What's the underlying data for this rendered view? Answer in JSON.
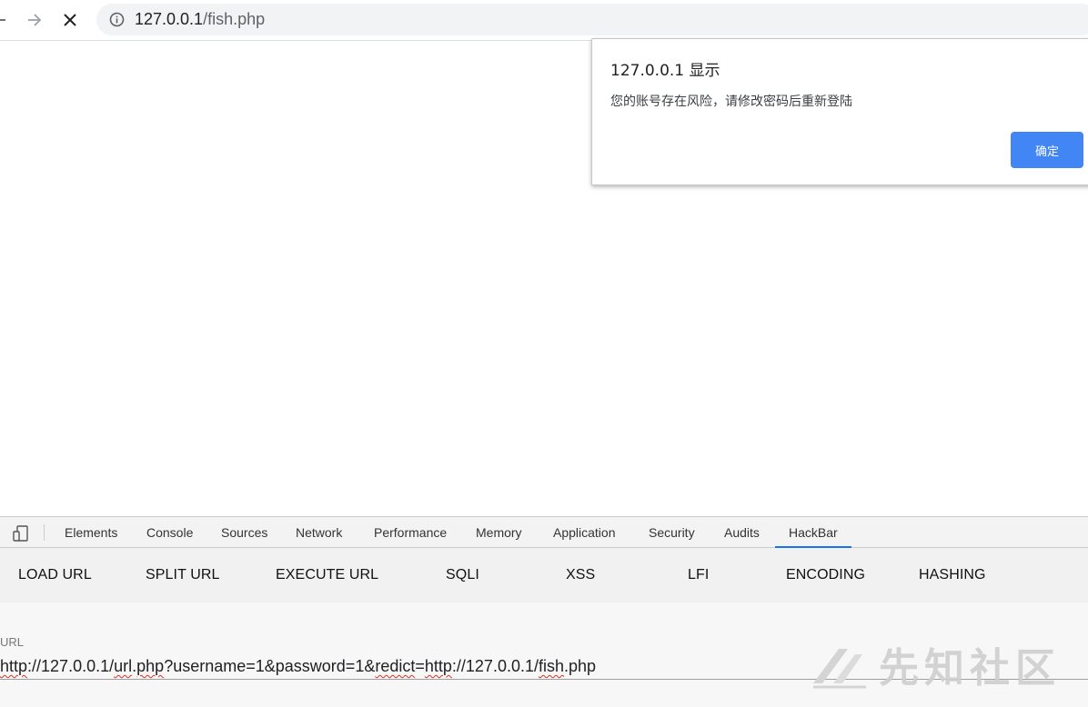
{
  "browser": {
    "address_host": "127.0.0.1",
    "address_path": "/fish.php"
  },
  "alert": {
    "title": "127.0.0.1 显示",
    "message": "您的账号存在风险，请修改密码后重新登陆",
    "ok_label": "确定"
  },
  "devtools": {
    "tabs": [
      {
        "label": "Elements"
      },
      {
        "label": "Console"
      },
      {
        "label": "Sources"
      },
      {
        "label": "Network"
      },
      {
        "label": "Performance"
      },
      {
        "label": "Memory"
      },
      {
        "label": "Application"
      },
      {
        "label": "Security"
      },
      {
        "label": "Audits"
      },
      {
        "label": "HackBar"
      }
    ],
    "active_tab": "HackBar"
  },
  "hackbar": {
    "menu": [
      {
        "label": "LOAD URL"
      },
      {
        "label": "SPLIT URL"
      },
      {
        "label": "EXECUTE URL"
      },
      {
        "label": "SQLI"
      },
      {
        "label": "XSS"
      },
      {
        "label": "LFI"
      },
      {
        "label": "ENCODING"
      },
      {
        "label": "HASHING"
      }
    ],
    "url_label": "URL",
    "url_parts": [
      "http",
      "://127.0.0.1/",
      "url",
      ".",
      "php",
      "?username=1&password=1&",
      "redict",
      "=",
      "http",
      "://127.0.0.1/",
      "fish",
      ".php"
    ]
  },
  "watermark": {
    "text": "先知社区"
  },
  "colors": {
    "accent": "#4285f4",
    "tab_underline": "#1a73e8"
  }
}
